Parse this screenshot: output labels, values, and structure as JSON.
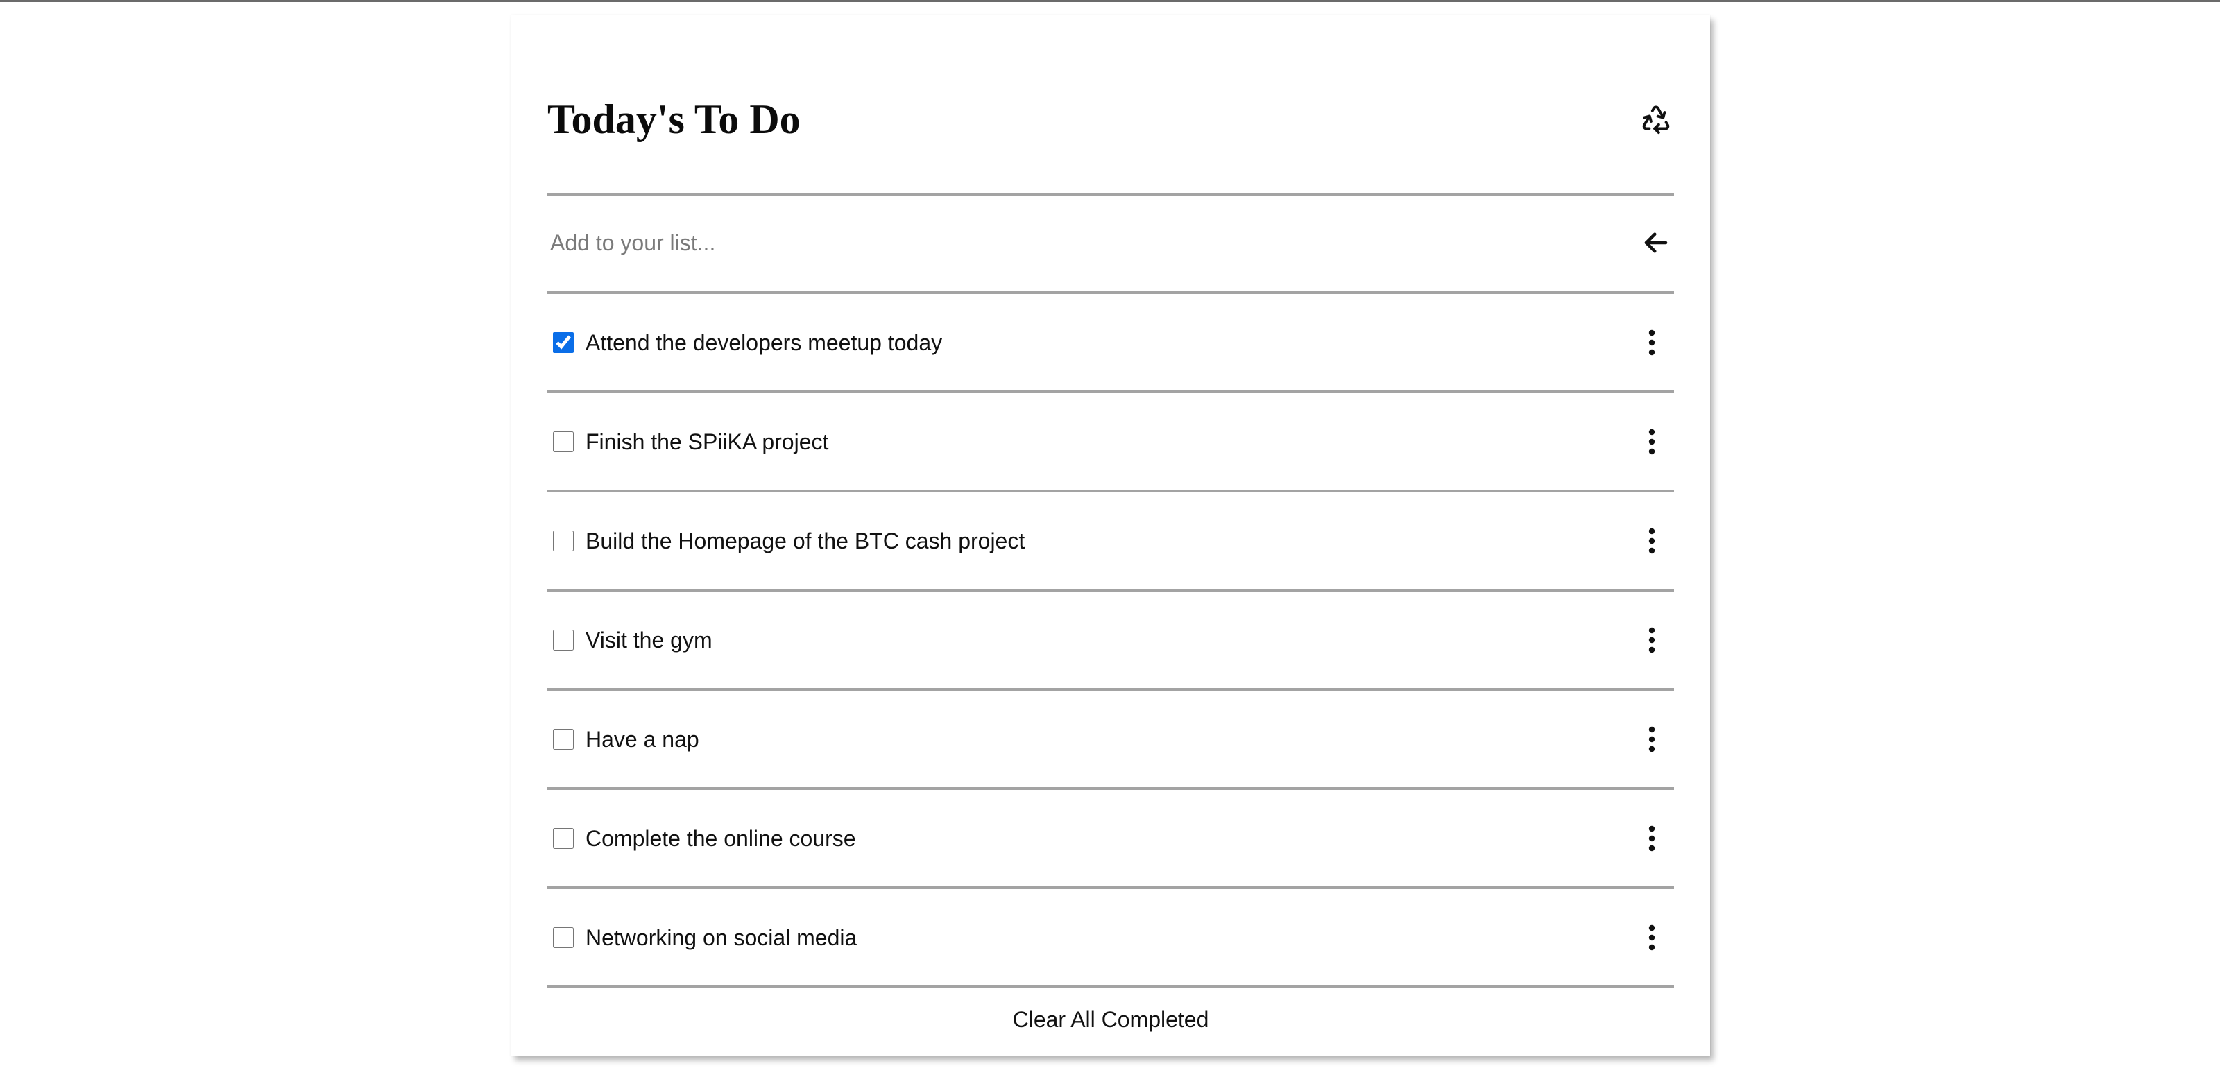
{
  "header": {
    "title": "Today's To Do",
    "refresh_icon": "recycle-icon"
  },
  "add_task": {
    "value": "",
    "placeholder": "Add to your list...",
    "submit_icon": "arrow-left-icon"
  },
  "tasks": [
    {
      "label": "Attend the developers meetup today",
      "completed": true
    },
    {
      "label": "Finish the SPiiKA project",
      "completed": false
    },
    {
      "label": "Build the Homepage of the BTC cash project",
      "completed": false
    },
    {
      "label": "Visit the gym",
      "completed": false
    },
    {
      "label": "Have a nap",
      "completed": false
    },
    {
      "label": "Complete the online course",
      "completed": false
    },
    {
      "label": "Networking on social media",
      "completed": false
    }
  ],
  "task_menu_icon": "more-vertical-icon",
  "footer": {
    "clear_label": "Clear All Completed"
  },
  "colors": {
    "checkbox_accent": "#0a6ee8",
    "divider": "#a3a3a3",
    "placeholder": "#7a7a7a",
    "text": "#111111"
  }
}
